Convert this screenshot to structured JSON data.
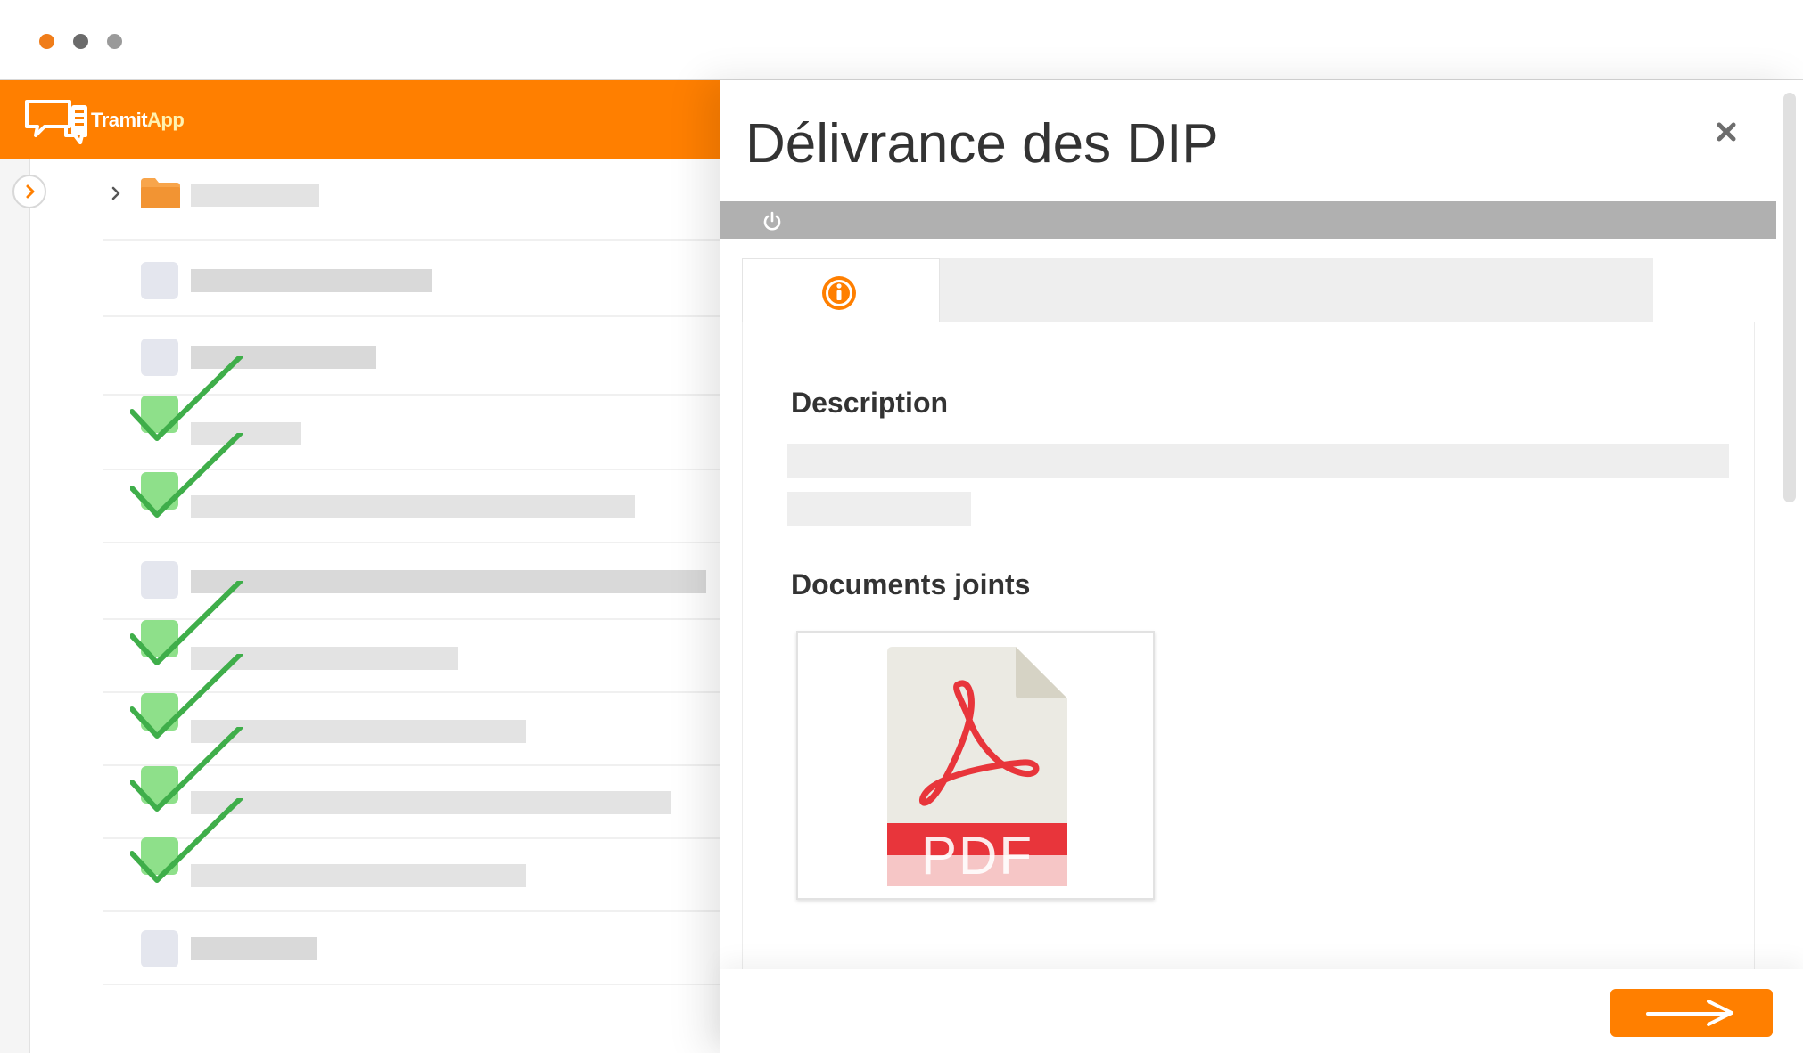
{
  "window": {
    "dots": [
      "#f07d1a",
      "#6b6b6b",
      "#9a9a9a"
    ]
  },
  "brand": {
    "name_part1": "Tramit",
    "name_part2": "App",
    "color": "#ff7f00"
  },
  "icons": {
    "expand": "chevron-right-icon",
    "folder": "folder-icon",
    "power": "power-icon",
    "info": "info-icon",
    "close": "close-icon",
    "next": "arrow-right-icon",
    "pdf": "pdf-file-icon"
  },
  "panel": {
    "title": "Délivrance des DIP",
    "close_glyph": "×",
    "power_glyph": "⏻",
    "section_description": "Description",
    "section_documents": "Documents joints",
    "pdf_label": "PDF"
  },
  "list": {
    "checked_rows": 6,
    "unchecked_rows": 4
  }
}
